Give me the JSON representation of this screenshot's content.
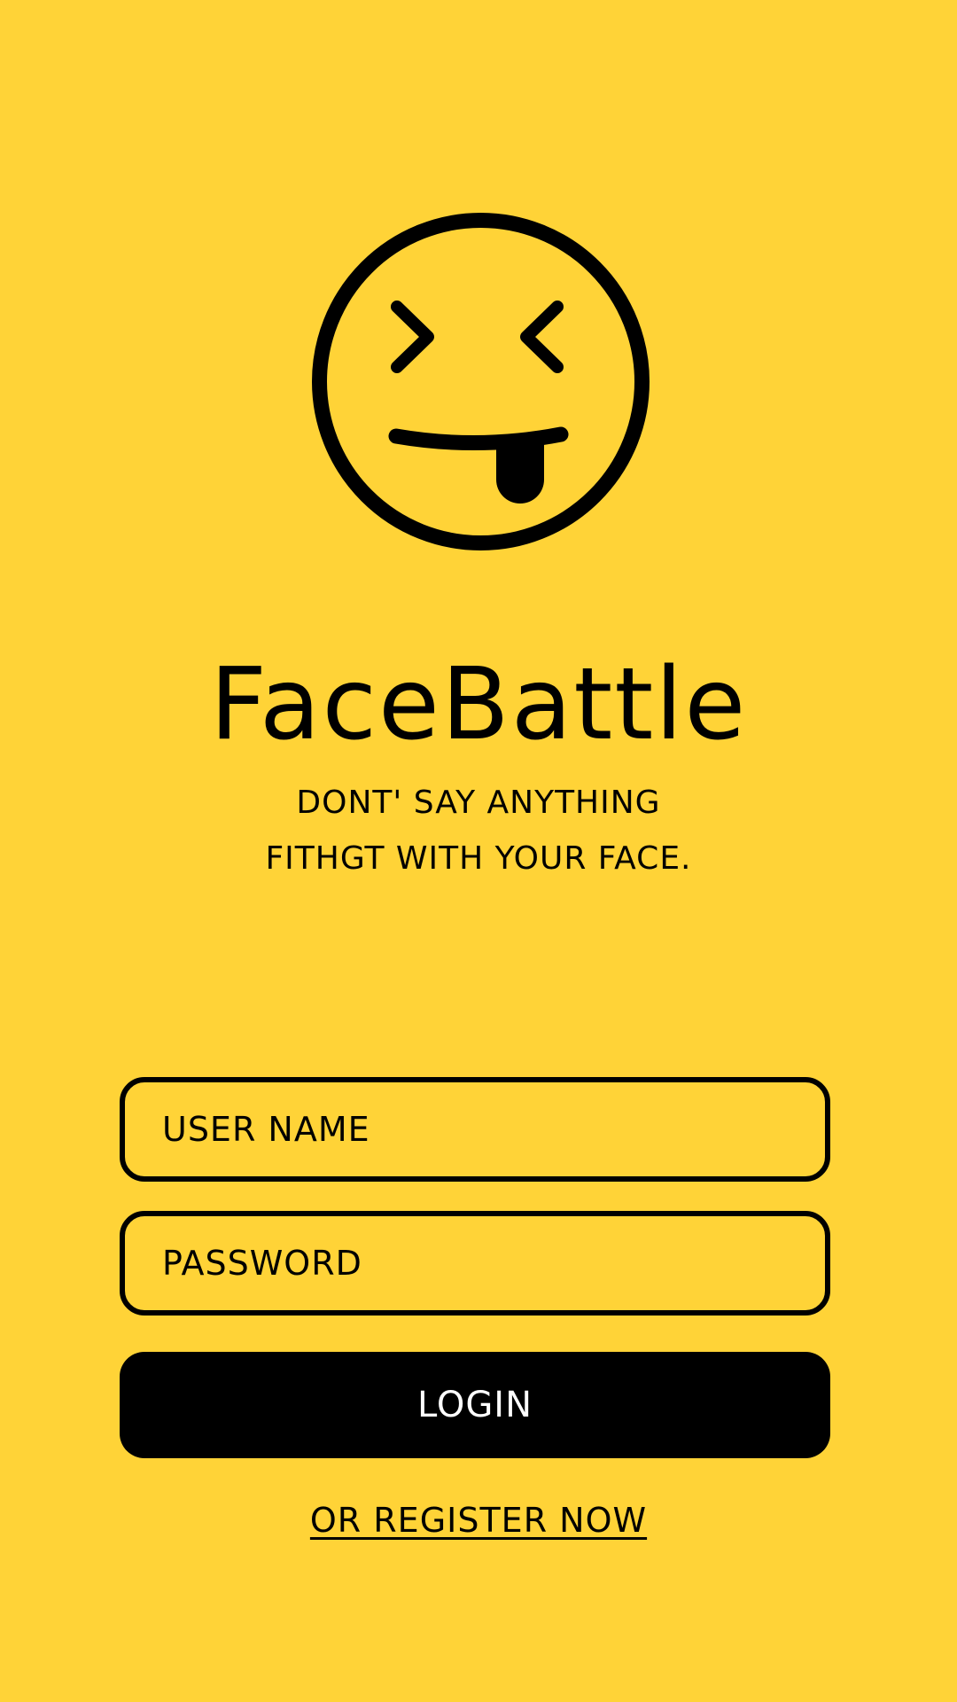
{
  "app": {
    "title": "FaceBattle",
    "tagline_line1": "DONT' SAY ANYTHING",
    "tagline_line2": "FITHGT WITH YOUR FACE."
  },
  "login_form": {
    "username_placeholder": "USER NAME",
    "password_placeholder": "PASSWORD",
    "login_label": "LOGIN",
    "register_label": "OR REGISTER NOW"
  },
  "icons": {
    "logo": "tongue-out-face-icon"
  },
  "colors": {
    "background": "#FFD337",
    "primary": "#000000",
    "button_text": "#FFFFFF"
  }
}
